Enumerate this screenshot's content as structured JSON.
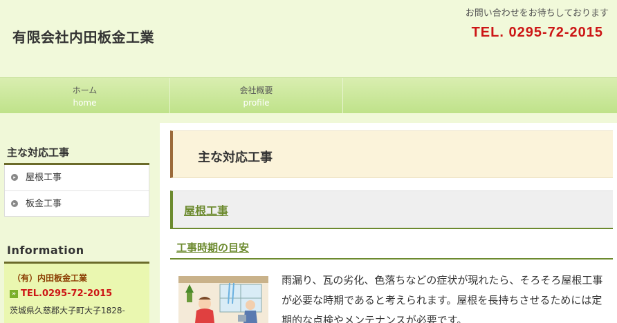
{
  "header": {
    "site_title": "有限会社内田板金工業",
    "tagline": "お問い合わせをお待ちしております",
    "tel": "TEL. 0295-72-2015"
  },
  "nav": {
    "items": [
      {
        "label": "ホーム",
        "sub": "home"
      },
      {
        "label": "会社概要",
        "sub": "profile"
      }
    ]
  },
  "sidebar": {
    "menu_heading": "主な対応工事",
    "menu_items": [
      {
        "label": "屋根工事"
      },
      {
        "label": "板金工事"
      }
    ],
    "info_heading": "Information",
    "info_company": "（有）内田板金工業",
    "info_tel": "TEL.0295-72-2015",
    "info_address": "茨城県久慈郡大子町大子1828-"
  },
  "main": {
    "title": "主な対応工事",
    "section_title": "屋根工事",
    "subsection_title": "工事時期の目安",
    "body": "雨漏り、瓦の劣化、色落ちなどの症状が現れたら、そろそろ屋根工事が必要な時期であると考えられます。屋根を長持ちさせるためには定期的な点検やメンテナンスが必要です。"
  },
  "colors": {
    "background": "#f0f8d8",
    "tel_red": "#cc1515",
    "nav_green": "#bfe28a",
    "section_green": "#6c8a2e",
    "title_brown": "#9b6a3a"
  }
}
